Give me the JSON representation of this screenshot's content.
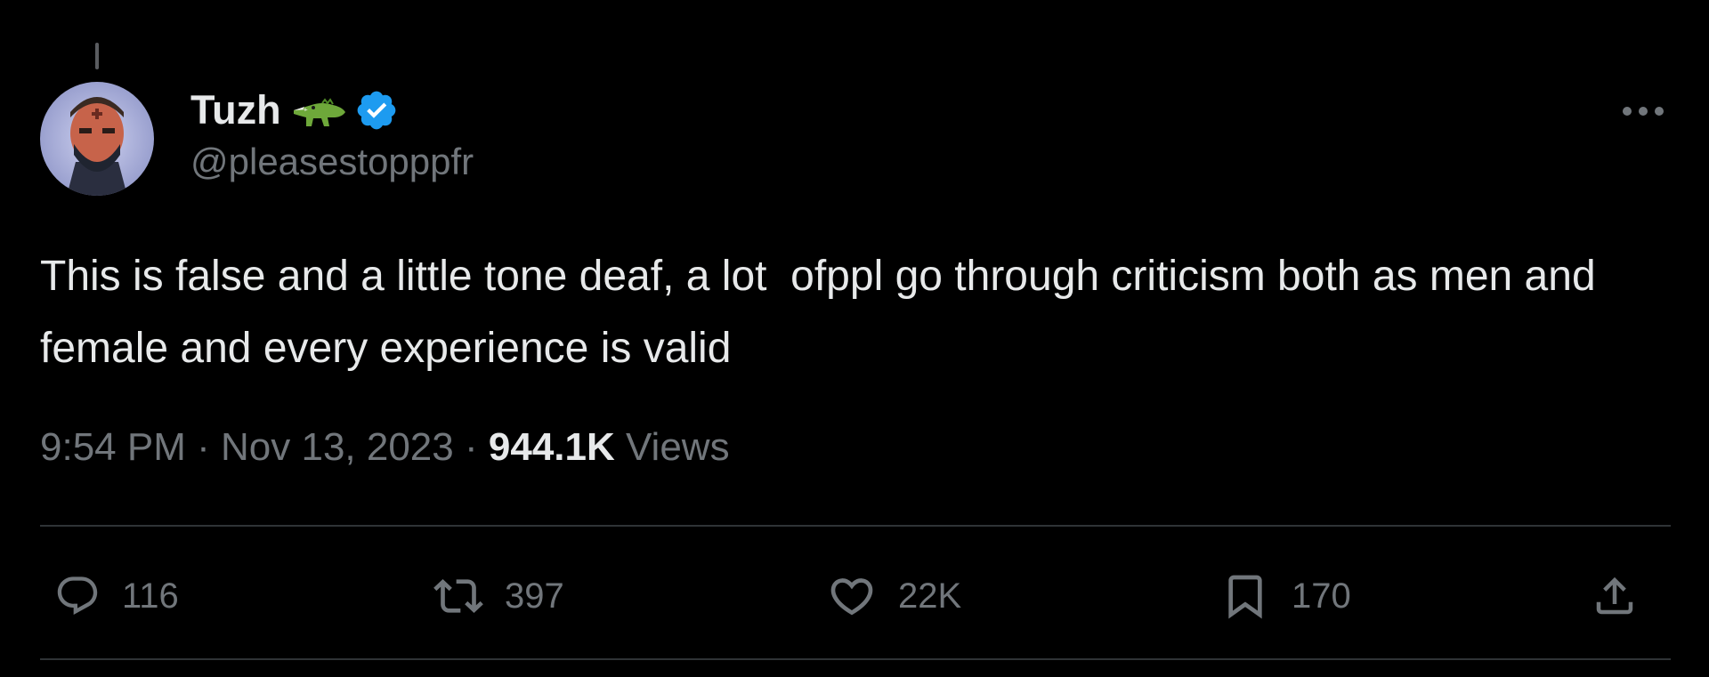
{
  "tweet": {
    "author": {
      "display_name": "Tuzh",
      "handle": "@pleasestopppfr",
      "badge_emoji": "crocodile-icon",
      "verified": true
    },
    "text": "This is false and a little tone deaf, a lot  ofppl go through criticism both as men and female and every experience is valid",
    "meta": {
      "time": "9:54 PM",
      "separator": "·",
      "date": "Nov 13, 2023",
      "views_count": "944.1K",
      "views_label": "Views"
    },
    "actions": {
      "replies": "116",
      "reposts": "397",
      "likes": "22K",
      "bookmarks": "170"
    }
  },
  "colors": {
    "background": "#000000",
    "text_primary": "#e7e9ea",
    "text_secondary": "#71767b",
    "divider": "#2f3336",
    "verified": "#1d9bf0"
  }
}
